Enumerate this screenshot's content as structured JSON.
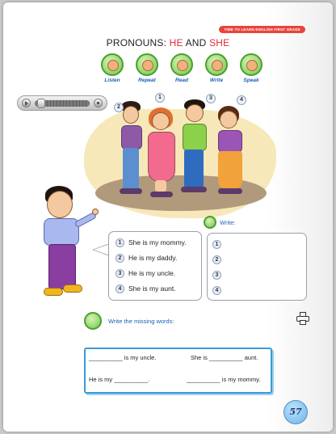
{
  "header": {
    "badge": "TIME TO LEARN ENGLISH FIRST GRADE",
    "title_prefix": "PRONOUNS: ",
    "title_he": "HE",
    "title_and": " AND ",
    "title_she": "SHE",
    "accent_color": "#e2283a"
  },
  "skills": [
    {
      "label": "Listen",
      "icon": "listen-icon"
    },
    {
      "label": "Repeat",
      "icon": "repeat-icon"
    },
    {
      "label": "Read",
      "icon": "read-icon"
    },
    {
      "label": "Write",
      "icon": "write-icon"
    },
    {
      "label": "Speak",
      "icon": "speak-icon"
    }
  ],
  "audio_player": {
    "position_fraction": 0.05
  },
  "scene_numbers": [
    "1",
    "2",
    "3",
    "4"
  ],
  "sentences": [
    {
      "num": "1",
      "text": "She is my mommy."
    },
    {
      "num": "2",
      "text": "He is my daddy."
    },
    {
      "num": "3",
      "text": "He is my uncle."
    },
    {
      "num": "4",
      "text": "She is my aunt."
    }
  ],
  "write_section": {
    "label": "Write:",
    "rows": [
      "1",
      "2",
      "3",
      "4"
    ]
  },
  "missing_words": {
    "label": "Write the missing words:",
    "line1_a": "__________ is my uncle.",
    "line1_b": "She is __________ aunt.",
    "line2_a": "He is my __________.",
    "line2_b": "__________ is my mommy."
  },
  "page_number": "57",
  "colors": {
    "link_blue": "#1c60b5",
    "box_blue": "#3a9bd8"
  }
}
